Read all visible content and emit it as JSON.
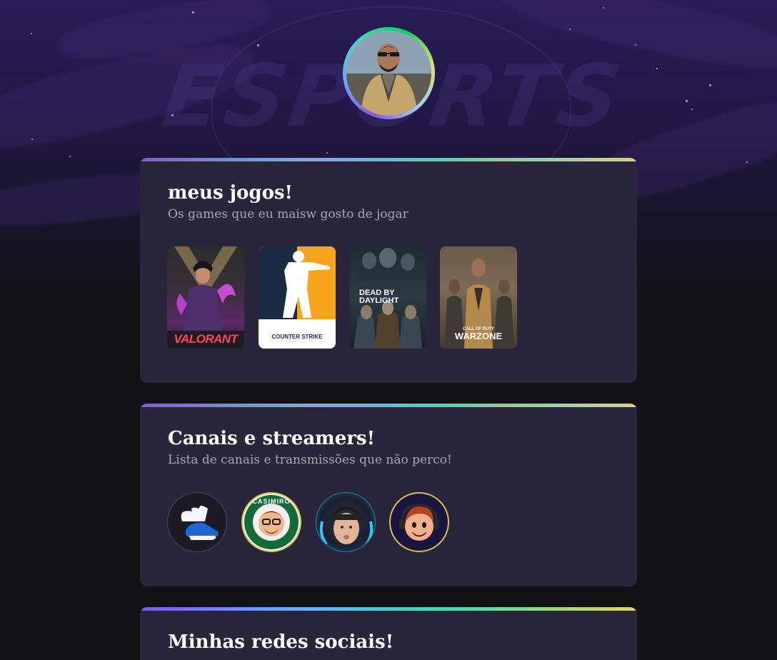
{
  "profile": {
    "avatar_icon": "profile-photo"
  },
  "background": {
    "watermark": "ESPORTS"
  },
  "games_section": {
    "title": "meus jogos!",
    "subtitle": "Os games que eu maisw gosto de jogar",
    "games": [
      {
        "name": "VALORANT",
        "icon": "valorant-cover"
      },
      {
        "name": "COUNTER STRIKE",
        "icon": "counter-strike-cover"
      },
      {
        "name": "DEAD BY DAYLIGHT",
        "icon": "dead-by-daylight-cover"
      },
      {
        "name": "WARZONE",
        "sub": "CALL OF DUTY",
        "icon": "warzone-cover"
      }
    ]
  },
  "channels_section": {
    "title": "Canais e streamers!",
    "subtitle": "Lista de canais e transmissões que não perco!",
    "channels": [
      {
        "icon": "winged-shoe-avatar"
      },
      {
        "label": "CASIMIRO",
        "icon": "casimiro-avatar"
      },
      {
        "icon": "streamer-cap-avatar"
      },
      {
        "icon": "cartoon-streamer-avatar"
      }
    ]
  },
  "social_section": {
    "title": "Minhas redes sociais!"
  },
  "colors": {
    "background": "#121214",
    "card": "#29253a",
    "accent_gradient": [
      "#8257e5",
      "#6fa8ff",
      "#44d7b6",
      "#e1d36a"
    ],
    "subtitle_text": "#a8a8b3"
  }
}
